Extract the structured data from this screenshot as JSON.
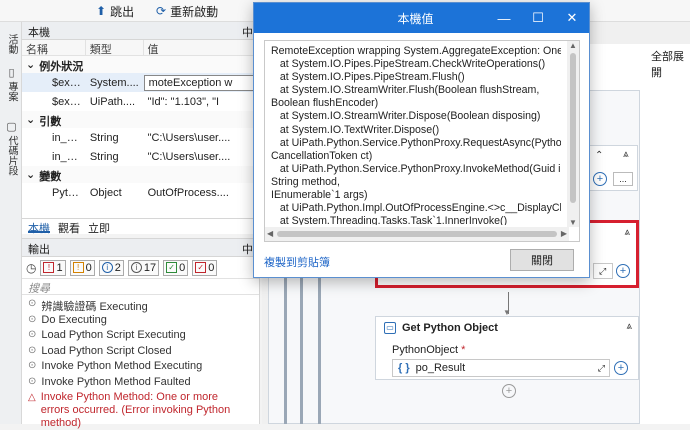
{
  "toolbar": {
    "stop_label": "跳出",
    "restart_label": "重新啟動"
  },
  "vertical_tabs": {
    "activities": "活動",
    "project": "專案",
    "snippets": "代碼片段"
  },
  "locals": {
    "title": "本機",
    "pin": "中",
    "columns": {
      "name": "名稱",
      "type": "類型",
      "value": "值"
    },
    "sections": [
      {
        "label": "例外狀況",
        "rows": [
          {
            "name": "$exc...",
            "type": "System....",
            "value": "moteException w"
          },
          {
            "name": "$exc...",
            "type": "UiPath....",
            "value": "\"Id\": \"1.103\",  \"I"
          }
        ]
      },
      {
        "label": "引數",
        "rows": [
          {
            "name": "in_Py...",
            "type": "String",
            "value": "\"C:\\Users\\user...."
          },
          {
            "name": "in_Py...",
            "type": "String",
            "value": "\"C:\\Users\\user...."
          }
        ]
      },
      {
        "label": "變數",
        "rows": [
          {
            "name": "Pyth...",
            "type": "Object",
            "value": "OutOfProcess...."
          }
        ]
      }
    ],
    "tabs": [
      "本機",
      "觀看",
      "立即"
    ]
  },
  "output": {
    "title": "輸出",
    "pin": "中",
    "filters": [
      {
        "icon": "!",
        "count": "1",
        "color": "#c0262d"
      },
      {
        "icon": "!",
        "count": "0",
        "color": "#d48200"
      },
      {
        "icon": "i",
        "count": "2",
        "color": "#1f5fa8"
      },
      {
        "icon": "i",
        "count": "17",
        "color": "#555555"
      },
      {
        "icon": "✓",
        "count": "0",
        "color": "#2e8b3a"
      },
      {
        "icon": "✓",
        "count": "0",
        "color": "#c0262d"
      }
    ],
    "search_placeholder": "搜尋",
    "logs": [
      "辨識驗證碼 Executing",
      "Do Executing",
      "Load Python Script Executing",
      "Load Python Script Closed",
      "Invoke Python Method Executing",
      "Invoke Python Method Faulted"
    ],
    "error_log": "Invoke Python Method: One or more errors occurred. (Error invoking Python method)"
  },
  "designer": {
    "right_label": "全部展開",
    "get_python_title": "Get Python Object",
    "python_object_label": "PythonObject",
    "required_mark": "*",
    "po_result": "po_Result",
    "brace": "{ }"
  },
  "dialog": {
    "title": "本機值",
    "text": "RemoteException wrapping System.AggregateException: One or\n   at System.IO.Pipes.PipeStream.CheckWriteOperations()\n   at System.IO.Pipes.PipeStream.Flush()\n   at System.IO.StreamWriter.Flush(Boolean flushStream,\nBoolean flushEncoder)\n   at System.IO.StreamWriter.Dispose(Boolean disposing)\n   at System.IO.TextWriter.Dispose()\n   at UiPath.Python.Service.PythonProxy.RequestAsync(PythonRe\nCancellationToken ct)\n   at UiPath.Python.Service.PythonProxy.InvokeMethod(Guid insta\nString method,\nIEnumerable`1 args)\n   at UiPath.Python.Impl.OutOfProcessEngine.<>c__DisplayClass1\n   at System.Threading.Tasks.Task`1.InnerInvoke()\n   at System.Threading.ExecutionContext.RunFromThreadPoolDis",
    "copy_label": "複製到剪貼簿",
    "close_label": "關閉"
  }
}
